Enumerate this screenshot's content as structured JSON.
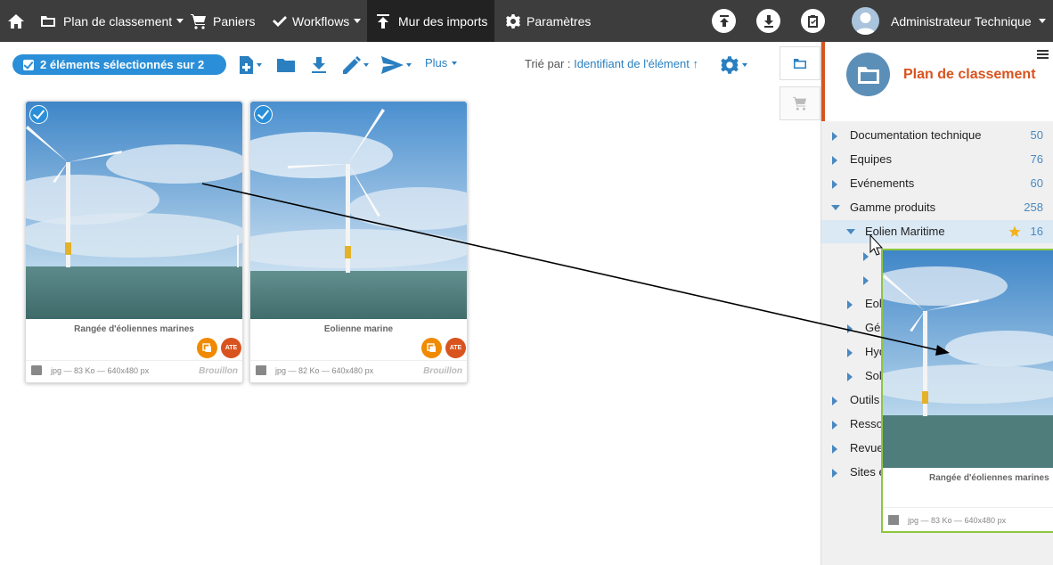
{
  "topnav": {
    "home_icon": "home-icon",
    "items": [
      {
        "label": "Plan de classement",
        "icon": "folder-icon",
        "has_caret": true
      },
      {
        "label": "Paniers",
        "icon": "cart-icon",
        "has_caret": false
      },
      {
        "label": "Workflows",
        "icon": "check-icon",
        "has_caret": true
      },
      {
        "label": "Mur des imports",
        "icon": "upload-icon",
        "has_caret": false,
        "active": true
      },
      {
        "label": "Paramètres",
        "icon": "gear-icon",
        "has_caret": false
      }
    ],
    "user_name": "Administrateur Technique"
  },
  "toolbar": {
    "selection_label": "2 éléments sélectionnés sur 2",
    "more_label": "Plus",
    "sort_label": "Trié par :",
    "sort_value": "Identifiant de l'élément ↑"
  },
  "cards": [
    {
      "title": "Rangée d'éoliennes marines",
      "badge": "ATE",
      "meta": "jpg — 83 Ko — 640x480 px",
      "status": "Brouillon",
      "selected": true
    },
    {
      "title": "Eolienne marine",
      "badge": "ATE",
      "meta": "jpg — 82 Ko — 640x480 px",
      "status": "Brouillon",
      "selected": true
    }
  ],
  "panel": {
    "title": "Plan de classement",
    "tree": [
      {
        "label": "Documentation technique",
        "count": "50"
      },
      {
        "label": "Equipes",
        "count": "76"
      },
      {
        "label": "Evénements",
        "count": "60"
      },
      {
        "label": "Gamme produits",
        "count": "258"
      },
      {
        "label": "Eolien Maritime",
        "count": "16"
      },
      {
        "label": "Eol"
      },
      {
        "label": "Géo"
      },
      {
        "label": "Hyd"
      },
      {
        "label": "Sol"
      },
      {
        "label": "Outils"
      },
      {
        "label": "Resso"
      },
      {
        "label": "Revue"
      },
      {
        "label": "Sites e"
      }
    ]
  },
  "ghost": {
    "title": "Rangée d'éoliennes marines",
    "meta": "jpg — 83 Ko — 640x480 px"
  },
  "colors": {
    "topbar": "#3d3d3d",
    "accent_blue": "#2a8fd8",
    "brand_orange": "#d9531e",
    "drop_green": "#8dc63f"
  }
}
